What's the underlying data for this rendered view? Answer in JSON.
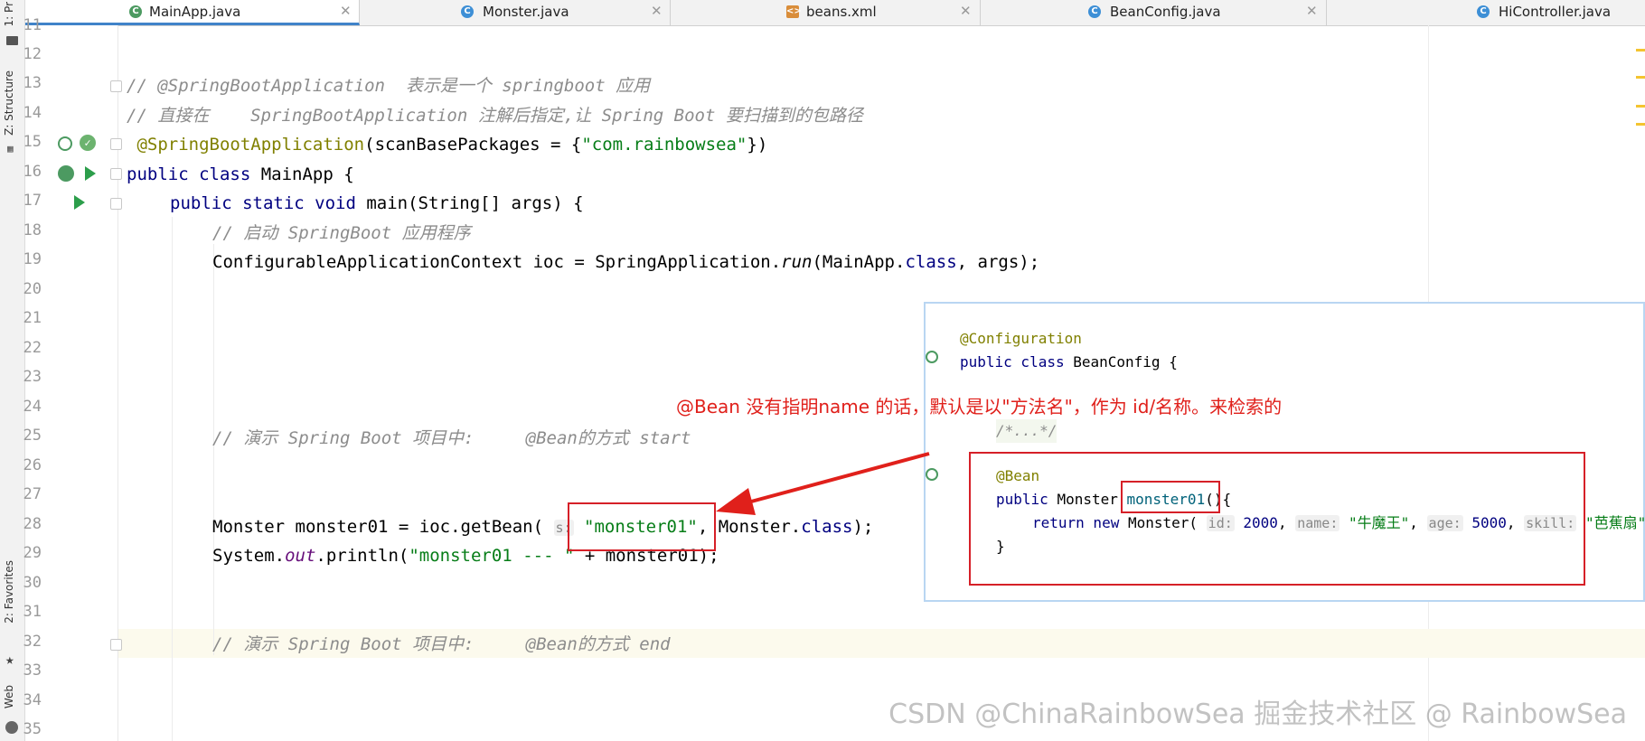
{
  "left_toolbar": {
    "project_tab": "1: Pr",
    "structure_tab": "Z: Structure",
    "favorites_tab": "2: Favorites",
    "web_tab": "Web"
  },
  "tabs": [
    {
      "label": "MainApp.java",
      "icon": "spring-class-icon",
      "active": true
    },
    {
      "label": "Monster.java",
      "icon": "class-icon",
      "active": false
    },
    {
      "label": "beans.xml",
      "icon": "xml-file-icon",
      "active": false
    },
    {
      "label": "BeanConfig.java",
      "icon": "class-icon",
      "active": false
    },
    {
      "label": "HiController.java",
      "icon": "class-icon",
      "active": false
    }
  ],
  "line_numbers": [
    "11",
    "12",
    "13",
    "14",
    "15",
    "16",
    "17",
    "18",
    "19",
    "20",
    "21",
    "22",
    "23",
    "24",
    "25",
    "26",
    "27",
    "28",
    "29",
    "30",
    "31",
    "32",
    "33",
    "34",
    "35"
  ],
  "code": {
    "l13": "// @SpringBootApplication  表示是一个 springboot 应用",
    "l14": "// 直接在    SpringBootApplication 注解后指定,让 Spring Boot 要扫描到的包路径",
    "l15_ann": "@SpringBootApplication",
    "l15_a": "(scanBasePackages = {",
    "l15_str": "\"com.rainbowsea\"",
    "l15_b": "})",
    "l16_kw": "public class ",
    "l16_rest": "MainApp {",
    "l17_kw": "public static void ",
    "l17_rest": "main(String[] args) {",
    "l18": "// 启动 SpringBoot 应用程序",
    "l19_a": "ConfigurableApplicationContext ioc = SpringApplication.",
    "l19_run": "run",
    "l19_b": "(MainApp.",
    "l19_kw": "class",
    "l19_c": ", args);",
    "l25": "// 演示 Spring Boot 项目中:     @Bean的方式 start",
    "l28_a": "Monster monster01 = ioc.getBean( ",
    "l28_hint": "s:",
    "l28_str": "\"monster01\"",
    "l28_b": ", Monster.",
    "l28_kw": "class",
    "l28_c": ");",
    "l29_a": "System.",
    "l29_out": "out",
    "l29_b": ".println(",
    "l29_str": "\"monster01 --- \"",
    "l29_c": " + monster01);",
    "l32": "// 演示 Spring Boot 项目中:     @Bean的方式 end"
  },
  "popup": {
    "l1": "@Configuration",
    "l2_kw": "public class ",
    "l2_rest": "BeanConfig {",
    "l3": "/*...*/",
    "l4": "@Bean",
    "l5_kw": "public ",
    "l5_type": "Monster ",
    "l5_name": "monster01",
    "l5_rest": "(){",
    "l6_kw": "return new ",
    "l6_a": "Monster( ",
    "hint_id": "id:",
    "val_id": "2000",
    "hint_name": "name:",
    "val_name": "\"牛魔王\"",
    "hint_age": "age:",
    "val_age": "5000",
    "hint_skill": "skill:",
    "val_skill": "\"芭蕉扇\"",
    "l6_end": ");",
    "l7": "}"
  },
  "annotation_text": "@Bean 没有指明name 的话，默认是以\"方法名\"，作为 id/名称。来检索的",
  "watermark": "CSDN @ChinaRainbowSea  掘金技术社区 @ RainbowSea",
  "colors": {
    "keyword": "#000080",
    "annotation": "#808000",
    "string": "#067d17",
    "comment": "#8c8c8c",
    "red_markup": "#d62028"
  }
}
